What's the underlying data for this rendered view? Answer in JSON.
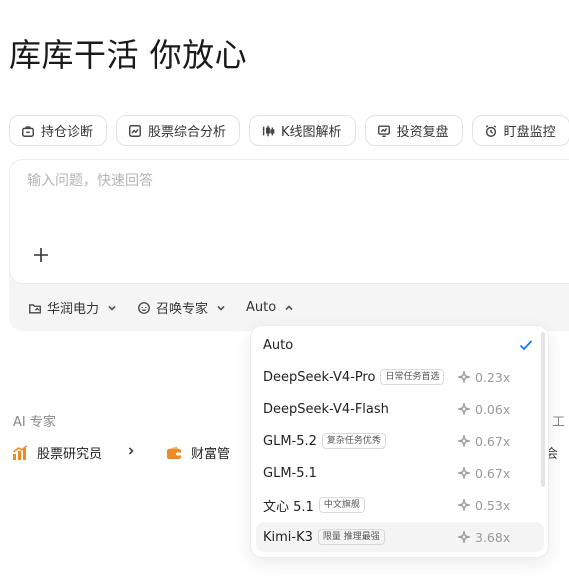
{
  "hero": {
    "title": "库库干活 你放心"
  },
  "chips": [
    {
      "label": "持仓诊断",
      "icon": "briefcase-icon"
    },
    {
      "label": "股票综合分析",
      "icon": "chart-line-icon"
    },
    {
      "label": "K线图解析",
      "icon": "candlestick-icon"
    },
    {
      "label": "投资复盘",
      "icon": "monitor-chart-icon"
    },
    {
      "label": "盯盘监控",
      "icon": "alarm-clock-icon"
    }
  ],
  "composer": {
    "placeholder": "输入问题，快速回答",
    "value": ""
  },
  "toolbar": {
    "stock_label": "华润电力",
    "expert_label": "召唤专家",
    "model_label": "Auto"
  },
  "experts_section": {
    "title": "AI 专家",
    "title_right": "工",
    "items": [
      {
        "label": "股票研究员",
        "icon": "bar-chart-icon",
        "color": "#f08a24"
      },
      {
        "label": "财富管",
        "icon": "wallet-icon",
        "color": "#f08a24"
      }
    ],
    "tail": "会"
  },
  "model_dropdown": {
    "items": [
      {
        "name": "Auto",
        "badge": "",
        "cost": "",
        "selected": true
      },
      {
        "name": "DeepSeek-V4-Pro",
        "badge": "日常任务首选",
        "cost": "0.23x",
        "selected": false
      },
      {
        "name": "DeepSeek-V4-Flash",
        "badge": "",
        "cost": "0.06x",
        "selected": false
      },
      {
        "name": "GLM-5.2",
        "badge": "复杂任务优秀",
        "cost": "0.67x",
        "selected": false
      },
      {
        "name": "GLM-5.1",
        "badge": "",
        "cost": "0.67x",
        "selected": false
      },
      {
        "name": "文心 5.1",
        "badge": "中文旗舰",
        "cost": "0.53x",
        "selected": false
      },
      {
        "name": "Kimi-K3",
        "badge": "限量 推理最强",
        "cost": "3.68x",
        "selected": false
      }
    ]
  },
  "colors": {
    "accent": "#1677ff",
    "expert_icon": "#f08a24"
  }
}
